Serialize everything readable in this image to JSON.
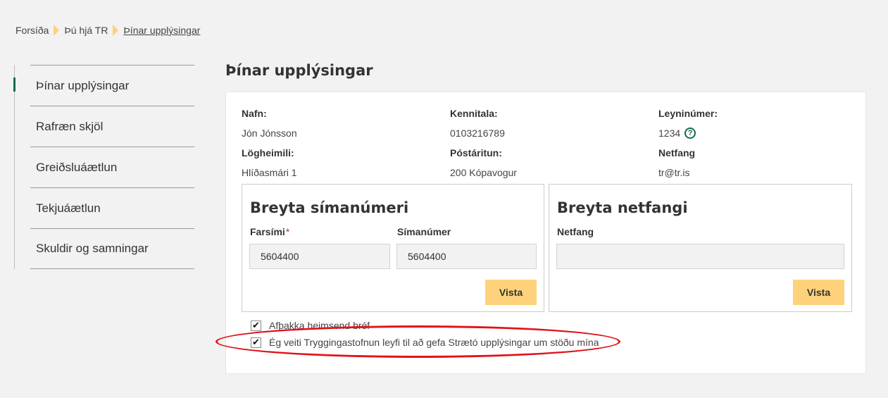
{
  "breadcrumb": {
    "home": "Forsíða",
    "section": "Þú hjá TR",
    "current": "Þínar upplýsingar"
  },
  "sidebar": {
    "items": [
      {
        "label": "Þínar upplýsingar"
      },
      {
        "label": "Rafræn skjöl"
      },
      {
        "label": "Greiðsluáætlun"
      },
      {
        "label": "Tekjuáætlun"
      },
      {
        "label": "Skuldir og samningar"
      }
    ]
  },
  "page": {
    "title": "Þínar upplýsingar"
  },
  "info": {
    "name_label": "Nafn:",
    "name_value": "Jón Jónsson",
    "kennitala_label": "Kennitala:",
    "kennitala_value": "0103216789",
    "pin_label": "Leyninúmer:",
    "pin_value": "1234",
    "pin_help_icon": "question-circle",
    "address_label": "Lögheimili:",
    "address_value": "Hlíðasmári 1",
    "postal_label": "Póstáritun:",
    "postal_value": "200 Kópavogur",
    "email_label": "Netfang",
    "email_value": "tr@tr.is"
  },
  "phone_card": {
    "title": "Breyta símanúmeri",
    "mobile_label": "Farsími",
    "mobile_required": "*",
    "mobile_value": "5604400",
    "phone_label": "Símanúmer",
    "phone_value": "5604400",
    "save_label": "Vista"
  },
  "email_card": {
    "title": "Breyta netfangi",
    "email_label": "Netfang",
    "email_value": "",
    "save_label": "Vista"
  },
  "checkboxes": [
    {
      "label": "Afþakka heimsend bréf",
      "checked": true
    },
    {
      "label": "Ég veiti Tryggingastofnun leyfi til að gefa Strætó upplýsingar um stöðu mína",
      "checked": true
    }
  ],
  "colors": {
    "accent_green": "#136b4e",
    "button_yellow": "#fdd27a",
    "annotation_red": "#e0131b"
  }
}
